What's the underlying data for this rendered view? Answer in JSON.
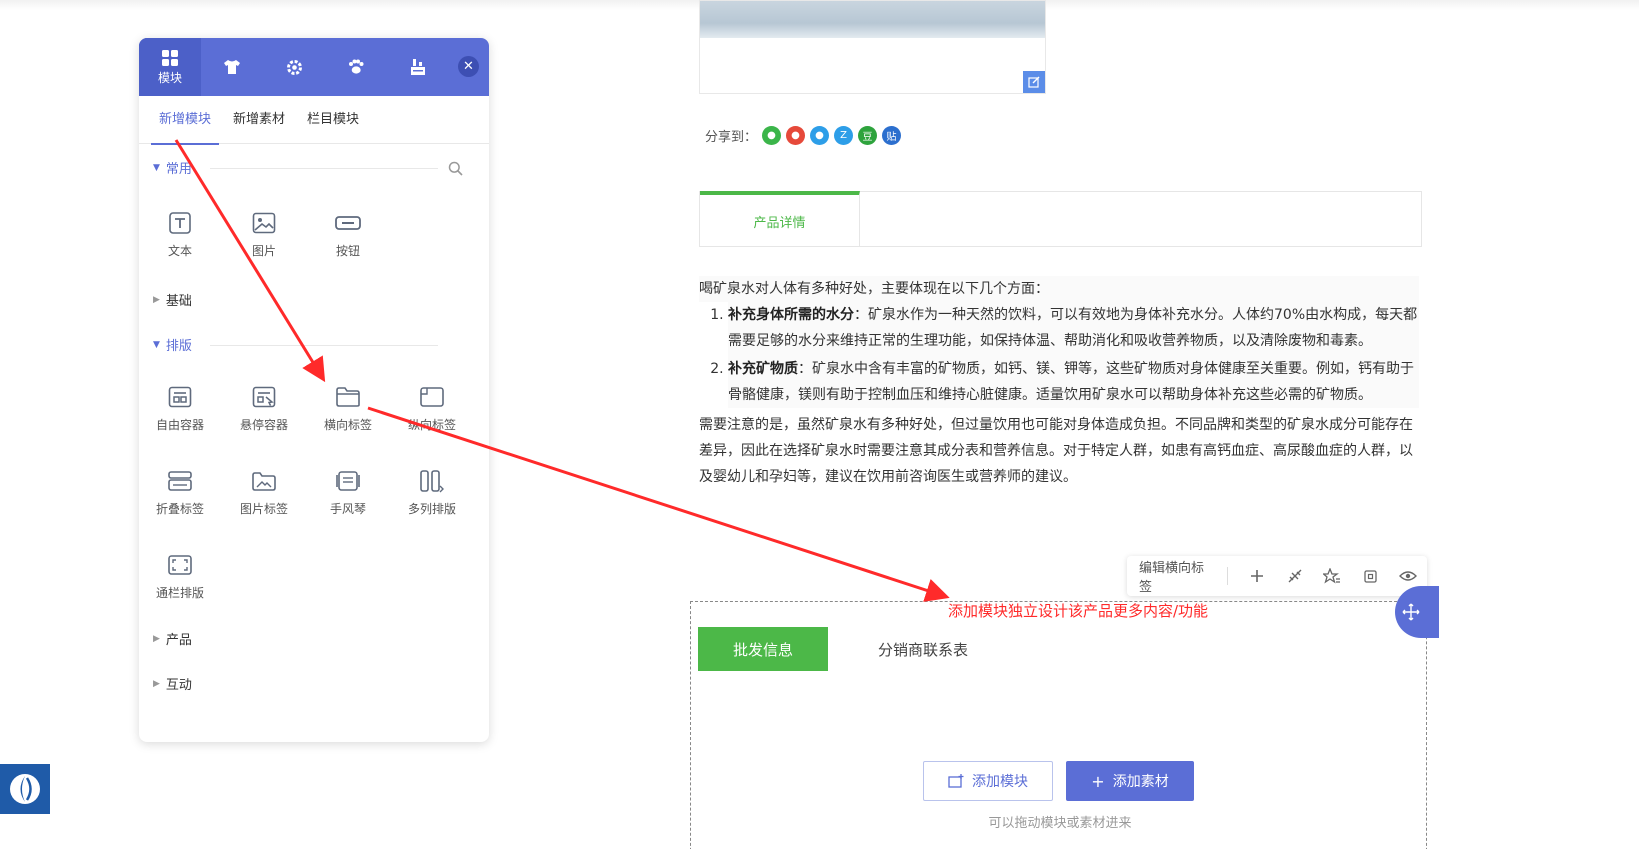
{
  "panel": {
    "head_tabs": [
      {
        "label": "模块",
        "icon": "grid-icon"
      },
      {
        "label": "",
        "icon": "shirt-icon"
      },
      {
        "label": "",
        "icon": "gear-icon"
      },
      {
        "label": "",
        "icon": "paw-icon"
      },
      {
        "label": "",
        "icon": "layers-icon"
      }
    ],
    "close": "✕",
    "subtabs": [
      "新增模块",
      "新增素材",
      "栏目模块"
    ],
    "sections": {
      "common": "常用",
      "basic": "基础",
      "layout": "排版",
      "product": "产品",
      "interact": "互动"
    },
    "common_items": [
      "文本",
      "图片",
      "按钮"
    ],
    "layout_items": [
      "自由容器",
      "悬停容器",
      "横向标签",
      "纵向标签",
      "折叠标签",
      "图片标签",
      "手风琴",
      "多列排版",
      "通栏排版"
    ]
  },
  "share": {
    "label": "分享到：",
    "icons": [
      {
        "name": "wechat-icon",
        "color": "#3bb54a",
        "glyph": "●"
      },
      {
        "name": "weibo-icon",
        "color": "#e6493a",
        "glyph": "●"
      },
      {
        "name": "qq-icon",
        "color": "#2d9ee8",
        "glyph": "●"
      },
      {
        "name": "qzone-icon",
        "color": "#2d9ee8",
        "glyph": "Z"
      },
      {
        "name": "douban-icon",
        "color": "#2ea33d",
        "glyph": "豆"
      },
      {
        "name": "tieba-icon",
        "color": "#2c6fce",
        "glyph": "贴"
      }
    ]
  },
  "detail_tab": "产品详情",
  "article": {
    "intro": "喝矿泉水对人体有多种好处，主要体现在以下几个方面：",
    "points": [
      {
        "title": "补充身体所需的水分",
        "body": "：矿泉水作为一种天然的饮料，可以有效地为身体补充水分。人体约70%由水构成，每天都需要足够的水分来维持正常的生理功能，如保持体温、帮助消化和吸收营养物质，以及清除废物和毒素。"
      },
      {
        "title": "补充矿物质",
        "body": "：矿泉水中含有丰富的矿物质，如钙、镁、钾等，这些矿物质对身体健康至关重要。例如，钙有助于骨骼健康，镁则有助于控制血压和维持心脏健康。适量饮用矿泉水可以帮助身体补充这些必需的矿物质。"
      }
    ],
    "note": "需要注意的是，虽然矿泉水有多种好处，但过量饮用也可能对身体造成负担。不同品牌和类型的矿泉水成分可能存在差异，因此在选择矿泉水时需要注意其成分表和营养信息。对于特定人群，如患有高钙血症、高尿酸血症的人群，以及婴幼儿和孕妇等，建议在饮用前咨询医生或营养师的建议。"
  },
  "editbar": {
    "label": "编辑横向标签"
  },
  "annotation": "添加模块独立设计该产品更多内容/功能",
  "module_tabs": [
    "批发信息",
    "分销商联系表"
  ],
  "buttons": {
    "add_module": "添加模块",
    "add_material": "添加素材"
  },
  "hint": "可以拖动模块或素材进来",
  "colors": {
    "accent": "#5b6ed6",
    "green": "#4cb848",
    "annotation": "#ff2a2a"
  }
}
